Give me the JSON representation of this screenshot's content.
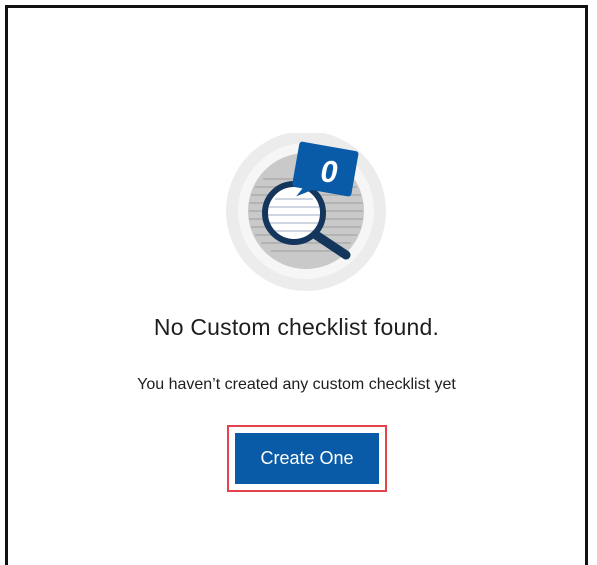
{
  "empty_state": {
    "illustration_icon": "empty-search-magnifier-icon",
    "badge_count": "0",
    "title": "No Custom checklist found.",
    "subtitle": "You haven’t created any custom checklist yet",
    "create_button_label": "Create One"
  },
  "colors": {
    "primary": "#0a5ba7",
    "highlight_border": "#e5434b",
    "text": "#1e1e1e",
    "circle_outer": "#ececec",
    "circle_inner": "#c9c9c9"
  }
}
